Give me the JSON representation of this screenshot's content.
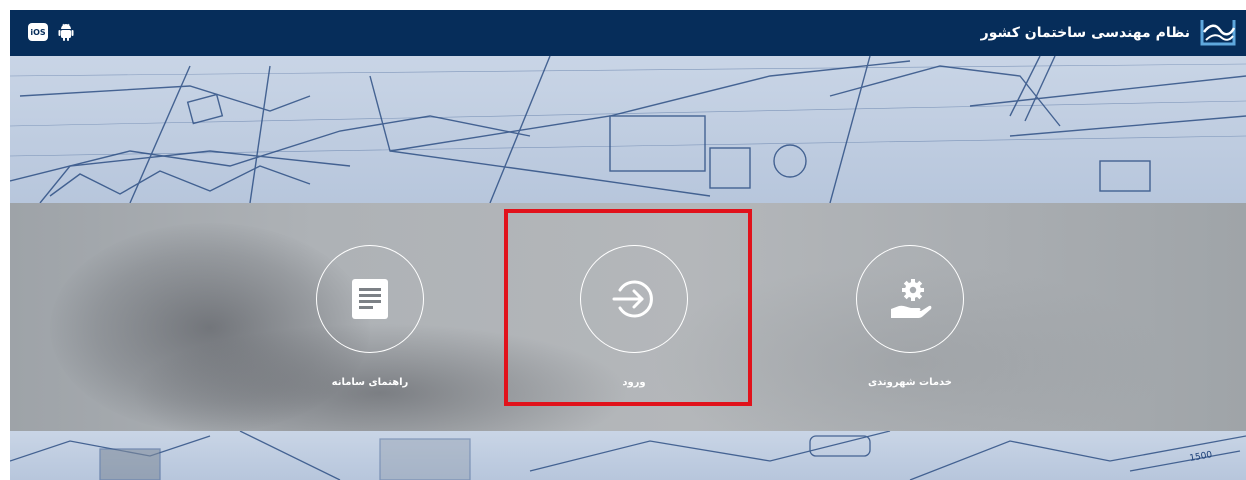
{
  "header": {
    "title": "نظام مهندسی ساختمان کشور",
    "logo_icon": "handshake-logo-icon",
    "apps": {
      "ios_label": "iOS",
      "android_icon": "android-icon"
    }
  },
  "menu": {
    "items": [
      {
        "label": "راهنمای سامانه",
        "icon": "document-lines-icon"
      },
      {
        "label": "ورود",
        "icon": "login-arrow-icon"
      },
      {
        "label": "خدمات شهروندی",
        "icon": "gear-hand-icon"
      }
    ]
  },
  "blueprint_labels": {
    "dimension": "1500"
  },
  "colors": {
    "header_bg": "#062d5a",
    "highlight": "#e1121b",
    "icon_white": "#ffffff"
  }
}
